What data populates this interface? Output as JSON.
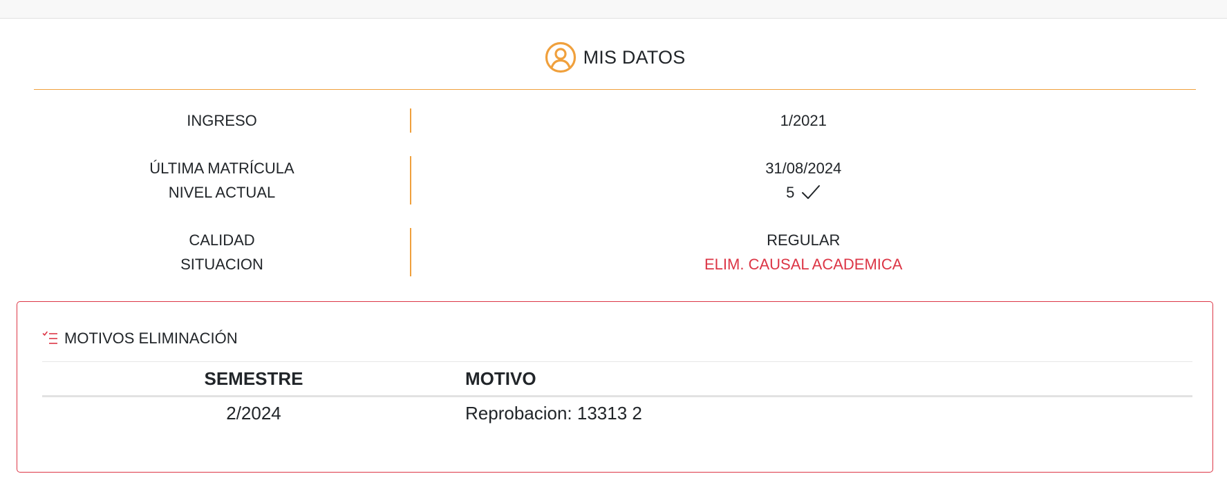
{
  "header": {
    "title": "MIS DATOS",
    "icon": "user-circle-icon",
    "accent_color": "#f0a03c"
  },
  "rows": [
    {
      "labels": [
        "INGRESO"
      ],
      "values": [
        "1/2021"
      ]
    },
    {
      "labels": [
        "ÚLTIMA MATRÍCULA",
        "NIVEL ACTUAL"
      ],
      "values": [
        "31/08/2024",
        "5"
      ]
    },
    {
      "labels": [
        "CALIDAD",
        "SITUACION"
      ],
      "values": [
        "REGULAR",
        "ELIM. CAUSAL ACADEMICA"
      ]
    }
  ],
  "nivel_actual_icon": "check-icon",
  "situacion_color": "#dc3545",
  "motivos": {
    "title": "MOTIVOS ELIMINACIÓN",
    "icon": "list-check-icon",
    "border_color": "#dc3545",
    "columns": [
      "SEMESTRE",
      "MOTIVO"
    ],
    "rows": [
      {
        "semestre": "2/2024",
        "motivo": "Reprobacion: 13313 2"
      }
    ]
  }
}
